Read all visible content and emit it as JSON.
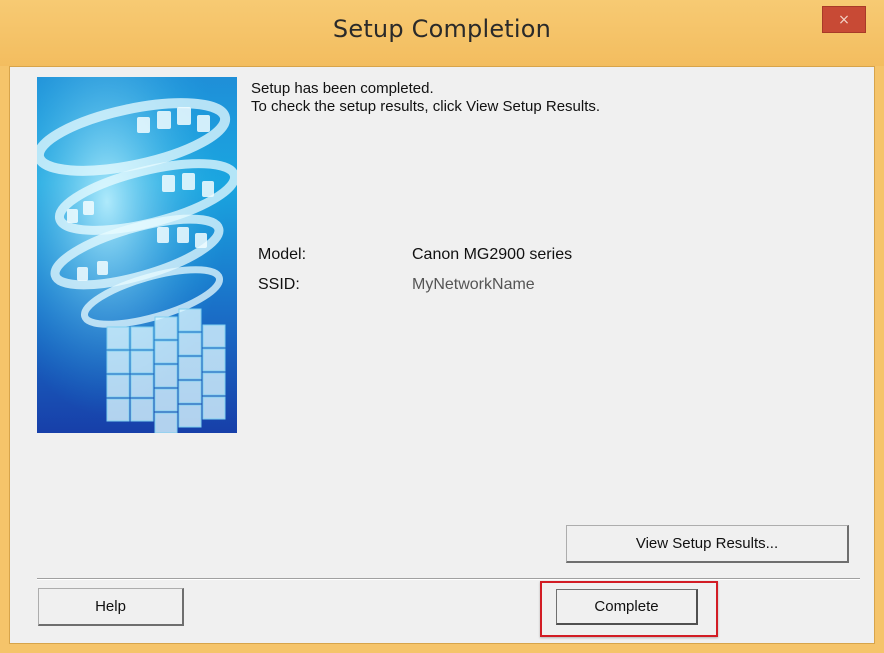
{
  "window": {
    "title": "Setup Completion",
    "close_glyph": "×",
    "colors": {
      "frame": "#f5c46a",
      "close": "#c84a35",
      "highlight": "#d21c24"
    }
  },
  "message": {
    "line1": "Setup has been completed.",
    "line2": "To check the setup results, click View Setup Results."
  },
  "info": {
    "model_label": "Model:",
    "model_value": "Canon MG2900 series",
    "ssid_label": "SSID:",
    "ssid_value": "MyNetworkName"
  },
  "buttons": {
    "view_results": "View Setup Results...",
    "help": "Help",
    "complete": "Complete"
  }
}
